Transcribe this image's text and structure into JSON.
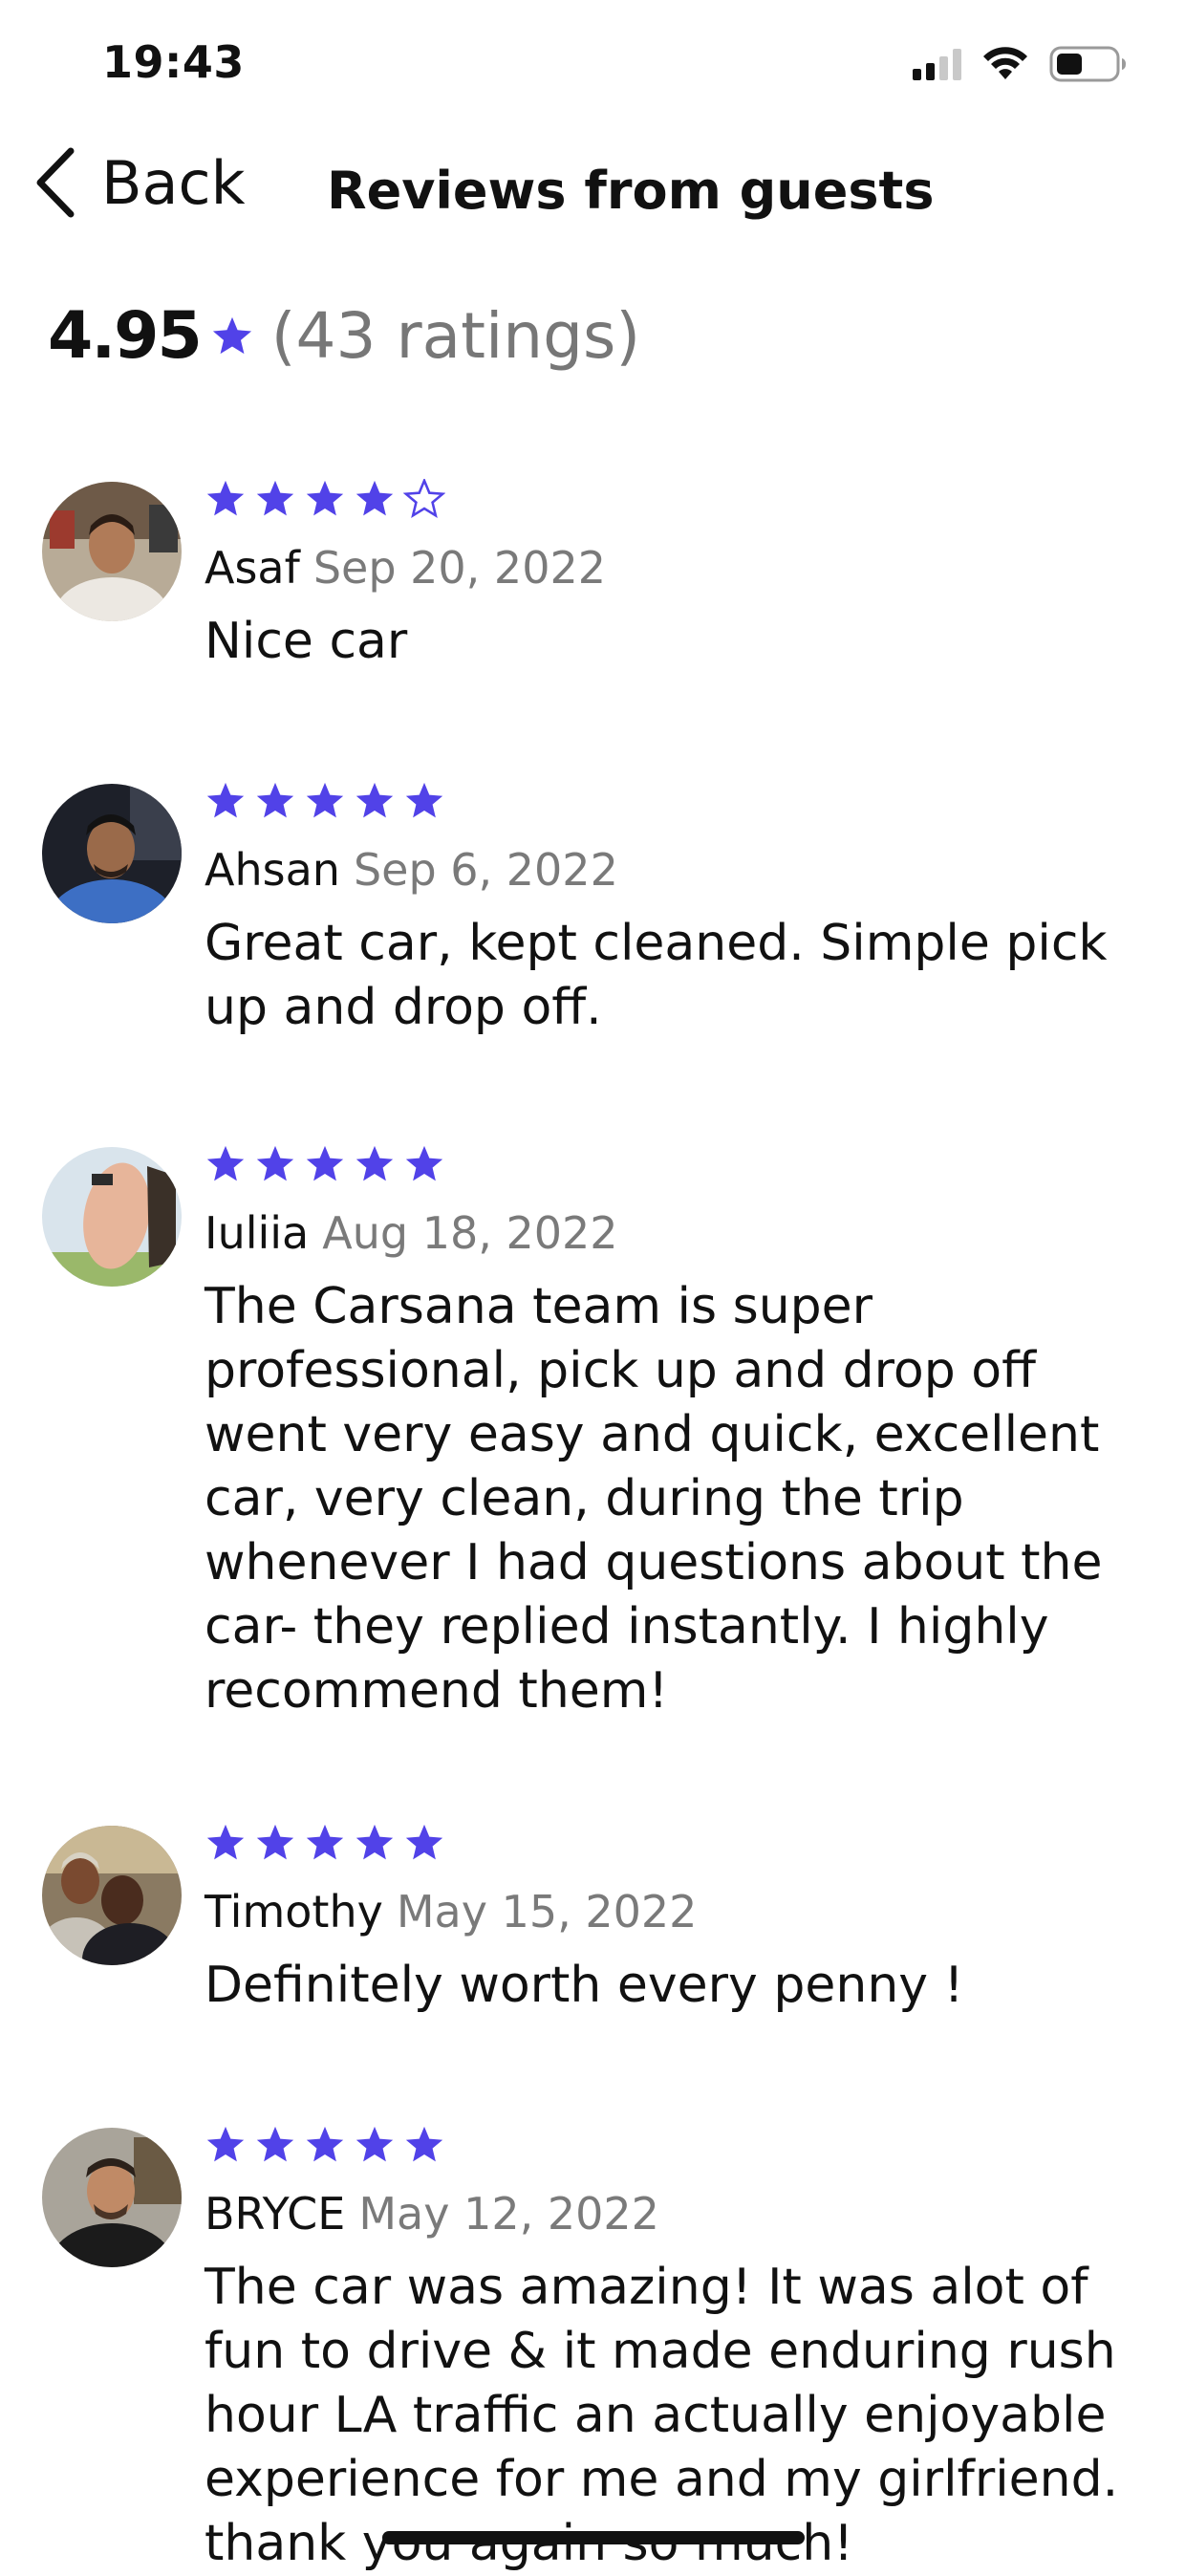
{
  "status_bar": {
    "time": "19:43"
  },
  "header": {
    "back_label": "Back",
    "title": "Reviews from guests"
  },
  "summary": {
    "rating": "4.95",
    "ratings_count": "(43 ratings)"
  },
  "colors": {
    "accent": "#5142E8",
    "secondary_text": "#7A7A7A",
    "primary_text": "#111111"
  },
  "reviews": [
    {
      "name": "Asaf",
      "date": "Sep 20, 2022",
      "stars": 4,
      "text": "Nice car"
    },
    {
      "name": "Ahsan",
      "date": "Sep 6, 2022",
      "stars": 5,
      "text": "Great car, kept cleaned. Simple pick up and drop off."
    },
    {
      "name": "Iuliia",
      "date": "Aug 18, 2022",
      "stars": 5,
      "text": "The Carsana team is super professional, pick up and drop off went very easy and quick, excellent car, very clean, during the trip whenever I had questions about the car- they replied instantly. I highly recommend them!"
    },
    {
      "name": "Timothy",
      "date": "May 15, 2022",
      "stars": 5,
      "text": "Definitely worth every penny !"
    },
    {
      "name": "BRYCE",
      "date": "May 12, 2022",
      "stars": 5,
      "text": "The car was amazing! It was alot of fun to drive & it made enduring rush hour LA traffic an actually enjoyable experience for me and my girlfriend. thank you again so much!"
    }
  ]
}
